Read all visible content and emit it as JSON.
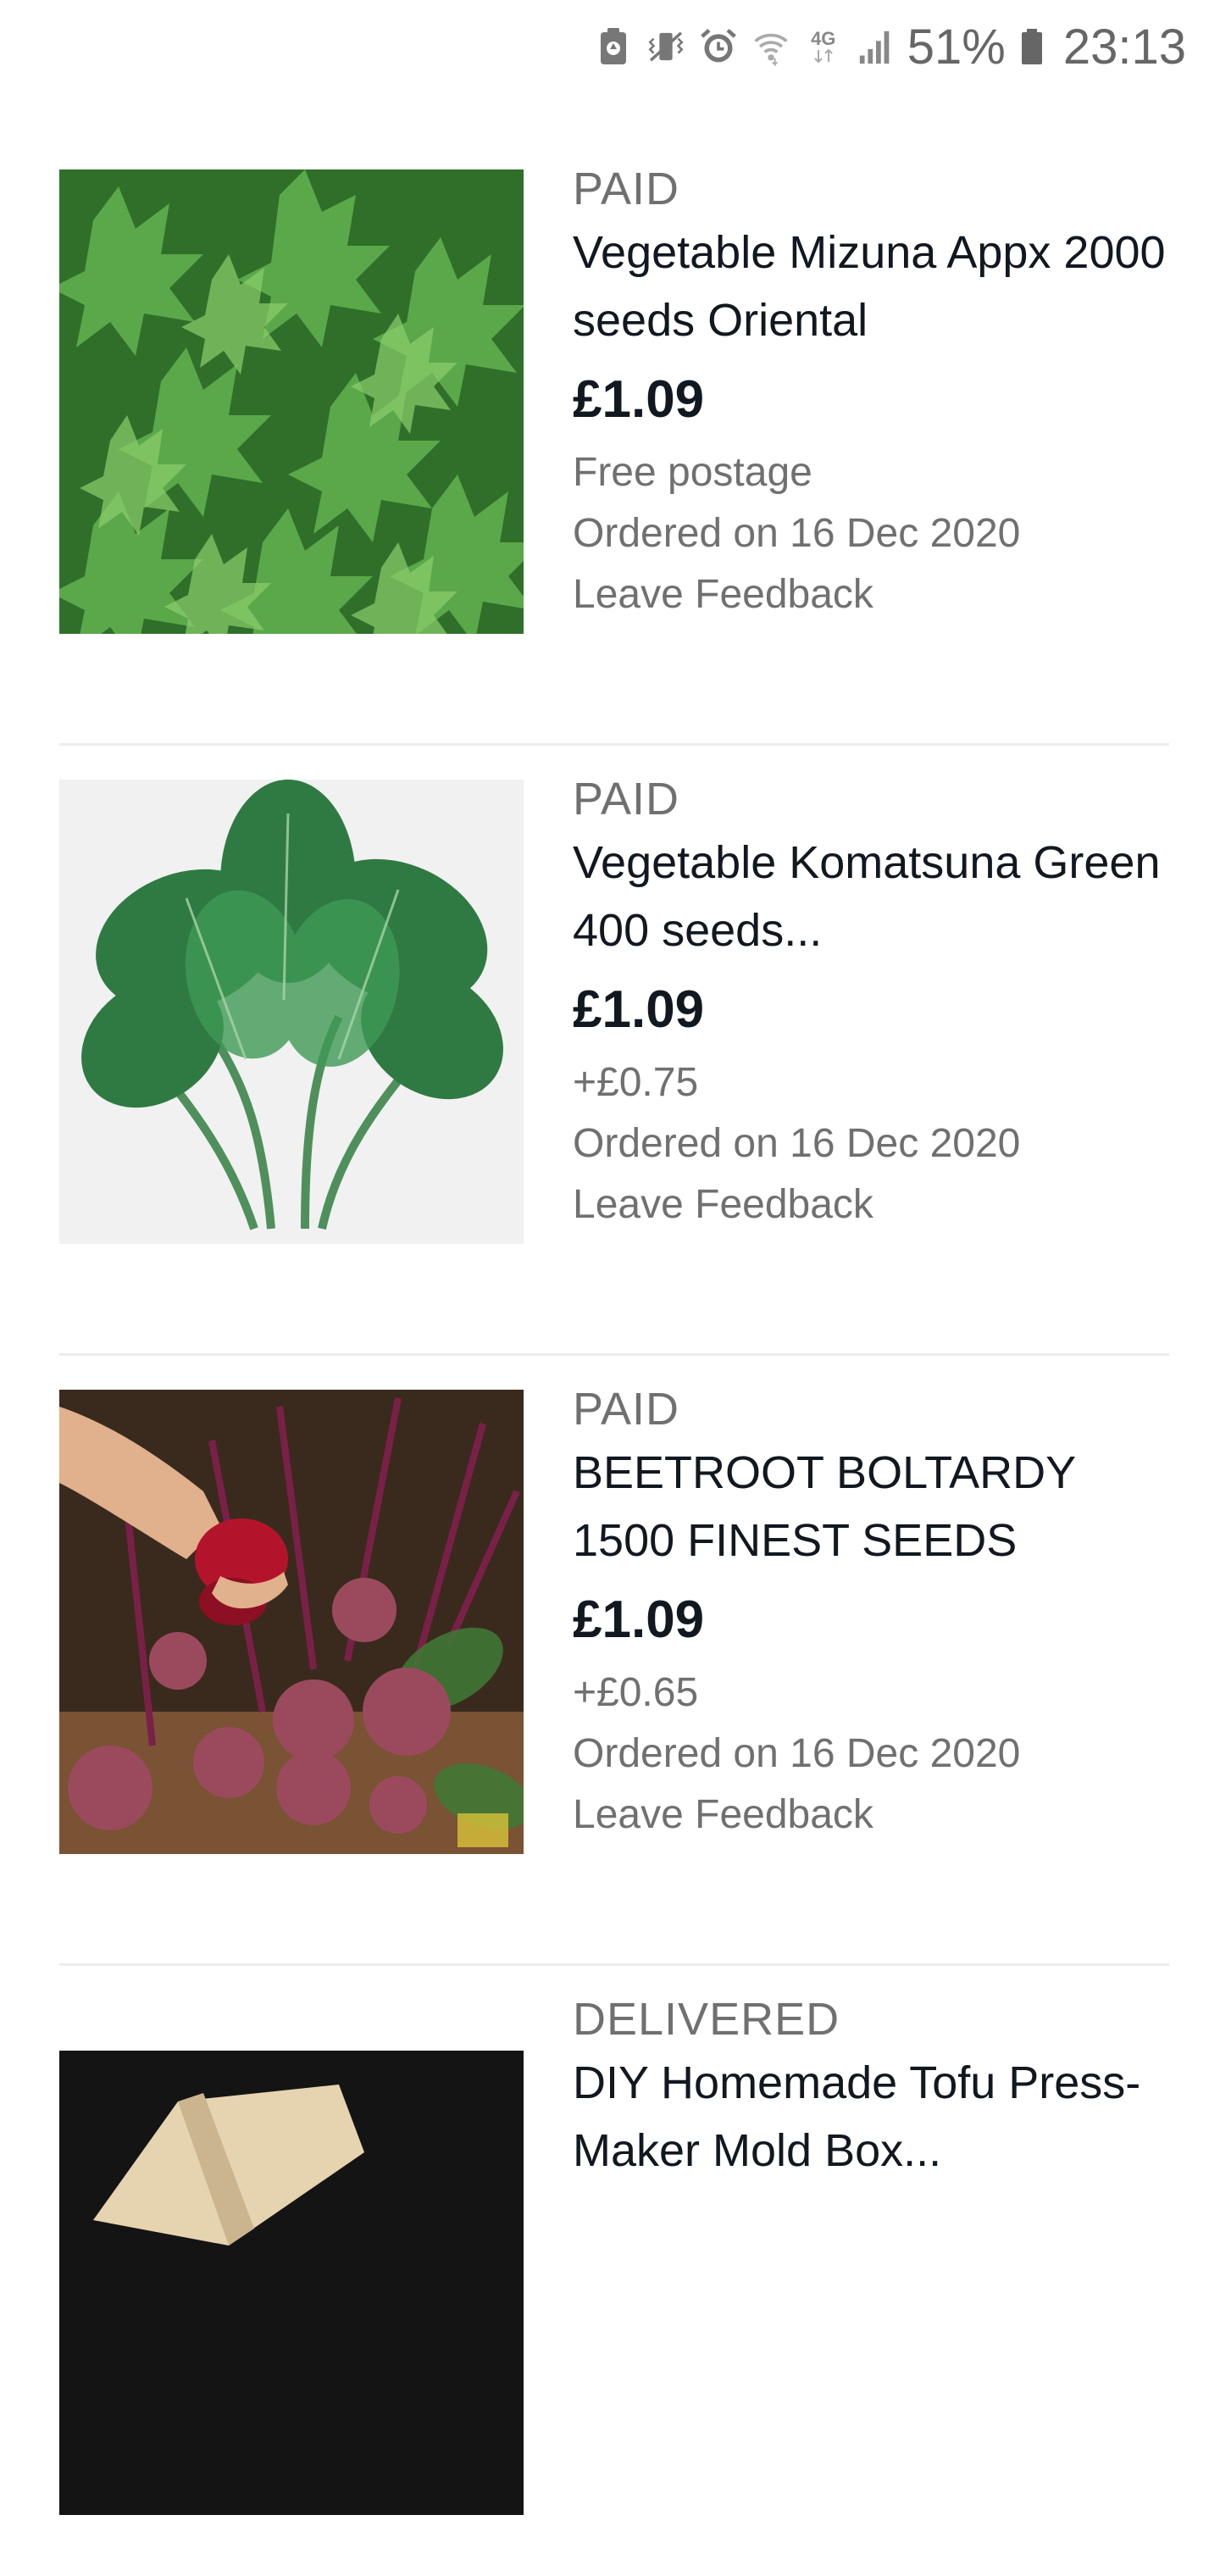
{
  "status_bar": {
    "network": "4G",
    "battery_percent": "51%",
    "time": "23:13",
    "icons": [
      "battery-saver-icon",
      "vibrate-icon",
      "alarm-icon",
      "wifi-icon",
      "4g-icon",
      "signal-icon",
      "battery-icon"
    ]
  },
  "orders": [
    {
      "status": "PAID",
      "title": "Vegetable Mizuna Appx 2000 seeds Oriental",
      "price": "£1.09",
      "postage": "Free postage",
      "ordered": "Ordered on 16 Dec 2020",
      "feedback": "Leave Feedback",
      "image": "mizuna-leaves"
    },
    {
      "status": "PAID",
      "title": "Vegetable Komatsuna Green 400 seeds...",
      "price": "£1.09",
      "postage": "+£0.75",
      "ordered": "Ordered on 16 Dec 2020",
      "feedback": "Leave Feedback",
      "image": "komatsuna-bunch"
    },
    {
      "status": "PAID",
      "title": "BEETROOT BOLTARDY 1500 FINEST SEEDS",
      "price": "£1.09",
      "postage": "+£0.65",
      "ordered": "Ordered on 16 Dec 2020",
      "feedback": "Leave Feedback",
      "image": "beetroot-harvest"
    },
    {
      "status": "DELIVERED",
      "title": "DIY Homemade Tofu Press-Maker Mold Box...",
      "image": "tofu-press"
    }
  ]
}
